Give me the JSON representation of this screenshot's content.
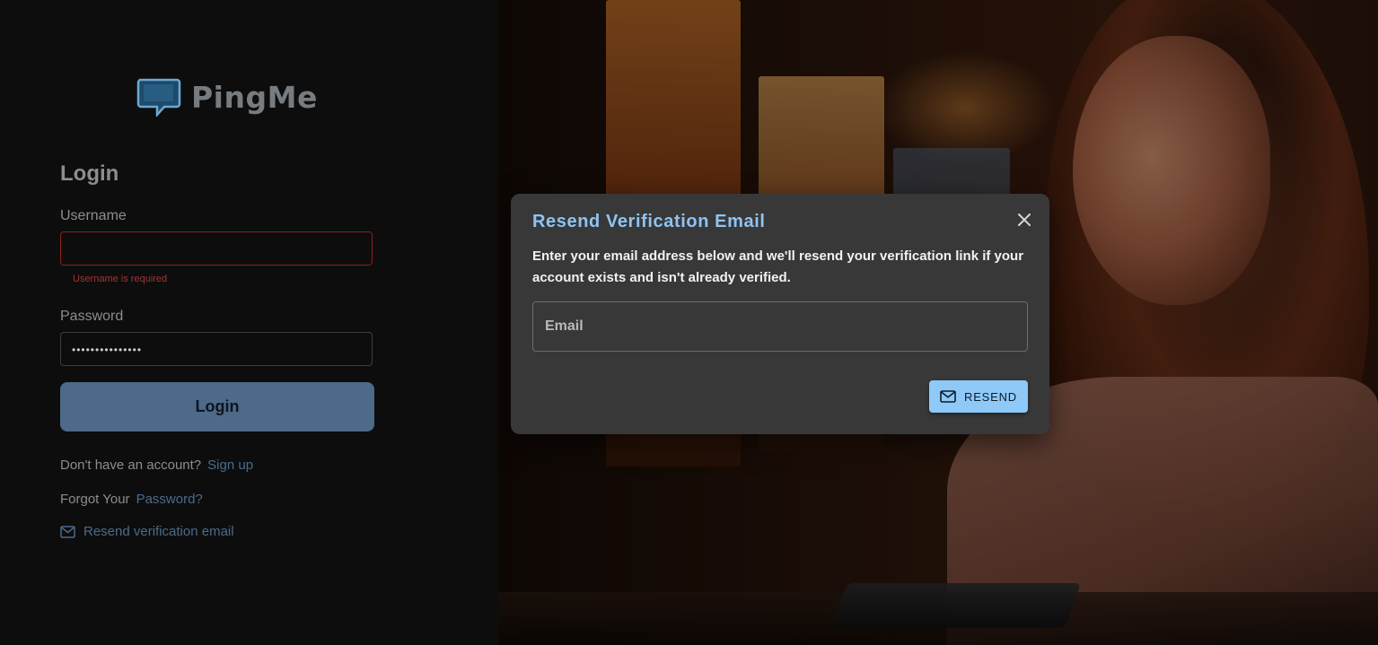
{
  "brand": {
    "name": "PingMe"
  },
  "login": {
    "heading": "Login",
    "username_label": "Username",
    "username_value": "",
    "username_error": "Username is required",
    "password_label": "Password",
    "password_value": "•••••••••••••••",
    "submit_label": "Login",
    "signup_prompt": "Don't have an account?",
    "signup_link": "Sign up",
    "forgot_prompt": "Forgot Your",
    "forgot_link": "Password?",
    "resend_link": "Resend verification email"
  },
  "modal": {
    "title": "Resend Verification Email",
    "description": "Enter your email address below and we'll resend your verification link if your account exists and isn't already verified.",
    "email_placeholder": "Email",
    "email_value": "",
    "resend_label": "RESEND"
  },
  "icons": {
    "logo": "chat-bubble-icon",
    "resend_link": "mail-icon",
    "resend_button": "mail-icon",
    "close": "close-icon"
  },
  "colors": {
    "accent": "#8ec9f8",
    "login_button": "#4d6a88",
    "error": "#a43434",
    "link": "#4b6b8d",
    "modal_bg": "#383838"
  }
}
